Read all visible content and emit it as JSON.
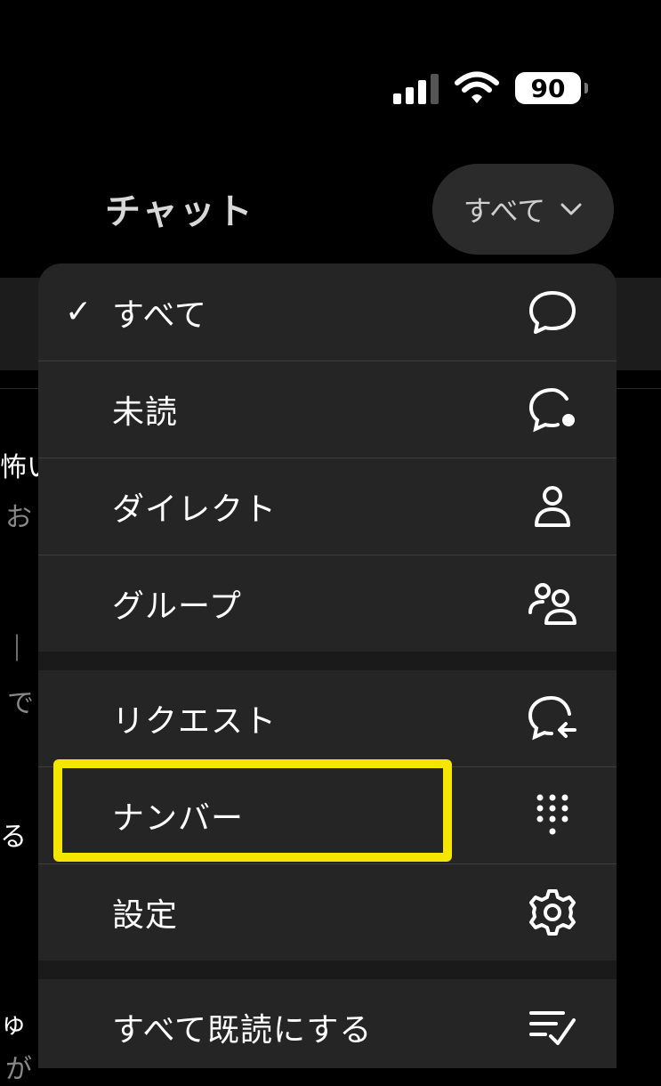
{
  "status_bar": {
    "battery": "90"
  },
  "header": {
    "title": "チャット",
    "filter_label": "すべて"
  },
  "background": {
    "row1_title": "怖い",
    "row1_sub": "お",
    "row2_title": "｜",
    "row2_sub": "で",
    "row3_title": "る",
    "row4_title": "ゅ",
    "row4_sub": "が"
  },
  "menu": {
    "items": [
      {
        "label": "すべて",
        "checked": true,
        "icon": "chat-bubble-icon"
      },
      {
        "label": "未読",
        "icon": "chat-bubble-dot-icon"
      },
      {
        "label": "ダイレクト",
        "icon": "person-icon"
      },
      {
        "label": "グループ",
        "icon": "people-icon"
      },
      {
        "label": "リクエスト",
        "icon": "chat-request-icon"
      },
      {
        "label": "ナンバー",
        "icon": "keypad-icon"
      },
      {
        "label": "設定",
        "icon": "gear-icon"
      },
      {
        "label": "すべて既読にする",
        "icon": "checklist-icon"
      }
    ],
    "check_mark": "✓"
  },
  "colors": {
    "highlight": "#f5e600",
    "menu_bg": "#252525",
    "background": "#000000"
  }
}
